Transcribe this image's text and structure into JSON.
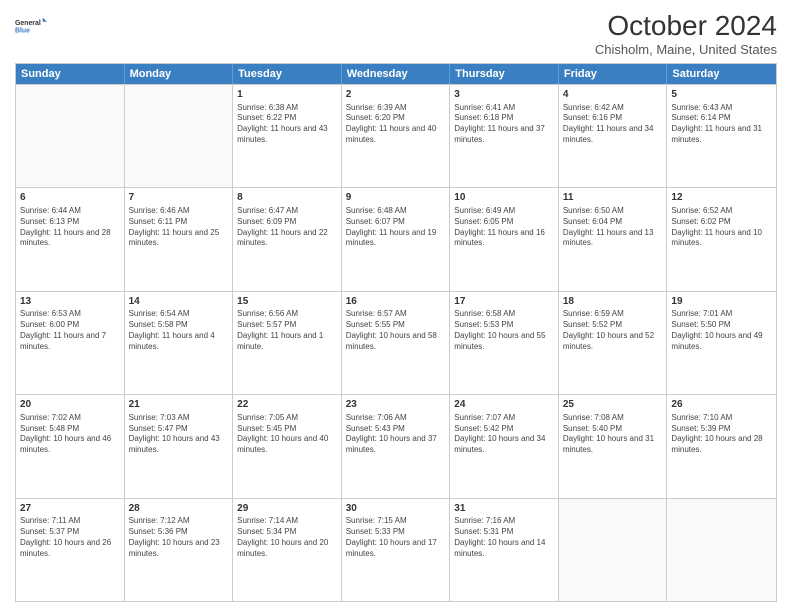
{
  "logo": {
    "line1": "General",
    "line2": "Blue",
    "icon_color": "#3a7fc1"
  },
  "header": {
    "title": "October 2024",
    "subtitle": "Chisholm, Maine, United States"
  },
  "weekdays": [
    "Sunday",
    "Monday",
    "Tuesday",
    "Wednesday",
    "Thursday",
    "Friday",
    "Saturday"
  ],
  "weeks": [
    [
      {
        "day": "",
        "sunrise": "",
        "sunset": "",
        "daylight": ""
      },
      {
        "day": "",
        "sunrise": "",
        "sunset": "",
        "daylight": ""
      },
      {
        "day": "1",
        "sunrise": "Sunrise: 6:38 AM",
        "sunset": "Sunset: 6:22 PM",
        "daylight": "Daylight: 11 hours and 43 minutes."
      },
      {
        "day": "2",
        "sunrise": "Sunrise: 6:39 AM",
        "sunset": "Sunset: 6:20 PM",
        "daylight": "Daylight: 11 hours and 40 minutes."
      },
      {
        "day": "3",
        "sunrise": "Sunrise: 6:41 AM",
        "sunset": "Sunset: 6:18 PM",
        "daylight": "Daylight: 11 hours and 37 minutes."
      },
      {
        "day": "4",
        "sunrise": "Sunrise: 6:42 AM",
        "sunset": "Sunset: 6:16 PM",
        "daylight": "Daylight: 11 hours and 34 minutes."
      },
      {
        "day": "5",
        "sunrise": "Sunrise: 6:43 AM",
        "sunset": "Sunset: 6:14 PM",
        "daylight": "Daylight: 11 hours and 31 minutes."
      }
    ],
    [
      {
        "day": "6",
        "sunrise": "Sunrise: 6:44 AM",
        "sunset": "Sunset: 6:13 PM",
        "daylight": "Daylight: 11 hours and 28 minutes."
      },
      {
        "day": "7",
        "sunrise": "Sunrise: 6:46 AM",
        "sunset": "Sunset: 6:11 PM",
        "daylight": "Daylight: 11 hours and 25 minutes."
      },
      {
        "day": "8",
        "sunrise": "Sunrise: 6:47 AM",
        "sunset": "Sunset: 6:09 PM",
        "daylight": "Daylight: 11 hours and 22 minutes."
      },
      {
        "day": "9",
        "sunrise": "Sunrise: 6:48 AM",
        "sunset": "Sunset: 6:07 PM",
        "daylight": "Daylight: 11 hours and 19 minutes."
      },
      {
        "day": "10",
        "sunrise": "Sunrise: 6:49 AM",
        "sunset": "Sunset: 6:05 PM",
        "daylight": "Daylight: 11 hours and 16 minutes."
      },
      {
        "day": "11",
        "sunrise": "Sunrise: 6:50 AM",
        "sunset": "Sunset: 6:04 PM",
        "daylight": "Daylight: 11 hours and 13 minutes."
      },
      {
        "day": "12",
        "sunrise": "Sunrise: 6:52 AM",
        "sunset": "Sunset: 6:02 PM",
        "daylight": "Daylight: 11 hours and 10 minutes."
      }
    ],
    [
      {
        "day": "13",
        "sunrise": "Sunrise: 6:53 AM",
        "sunset": "Sunset: 6:00 PM",
        "daylight": "Daylight: 11 hours and 7 minutes."
      },
      {
        "day": "14",
        "sunrise": "Sunrise: 6:54 AM",
        "sunset": "Sunset: 5:58 PM",
        "daylight": "Daylight: 11 hours and 4 minutes."
      },
      {
        "day": "15",
        "sunrise": "Sunrise: 6:56 AM",
        "sunset": "Sunset: 5:57 PM",
        "daylight": "Daylight: 11 hours and 1 minute."
      },
      {
        "day": "16",
        "sunrise": "Sunrise: 6:57 AM",
        "sunset": "Sunset: 5:55 PM",
        "daylight": "Daylight: 10 hours and 58 minutes."
      },
      {
        "day": "17",
        "sunrise": "Sunrise: 6:58 AM",
        "sunset": "Sunset: 5:53 PM",
        "daylight": "Daylight: 10 hours and 55 minutes."
      },
      {
        "day": "18",
        "sunrise": "Sunrise: 6:59 AM",
        "sunset": "Sunset: 5:52 PM",
        "daylight": "Daylight: 10 hours and 52 minutes."
      },
      {
        "day": "19",
        "sunrise": "Sunrise: 7:01 AM",
        "sunset": "Sunset: 5:50 PM",
        "daylight": "Daylight: 10 hours and 49 minutes."
      }
    ],
    [
      {
        "day": "20",
        "sunrise": "Sunrise: 7:02 AM",
        "sunset": "Sunset: 5:48 PM",
        "daylight": "Daylight: 10 hours and 46 minutes."
      },
      {
        "day": "21",
        "sunrise": "Sunrise: 7:03 AM",
        "sunset": "Sunset: 5:47 PM",
        "daylight": "Daylight: 10 hours and 43 minutes."
      },
      {
        "day": "22",
        "sunrise": "Sunrise: 7:05 AM",
        "sunset": "Sunset: 5:45 PM",
        "daylight": "Daylight: 10 hours and 40 minutes."
      },
      {
        "day": "23",
        "sunrise": "Sunrise: 7:06 AM",
        "sunset": "Sunset: 5:43 PM",
        "daylight": "Daylight: 10 hours and 37 minutes."
      },
      {
        "day": "24",
        "sunrise": "Sunrise: 7:07 AM",
        "sunset": "Sunset: 5:42 PM",
        "daylight": "Daylight: 10 hours and 34 minutes."
      },
      {
        "day": "25",
        "sunrise": "Sunrise: 7:08 AM",
        "sunset": "Sunset: 5:40 PM",
        "daylight": "Daylight: 10 hours and 31 minutes."
      },
      {
        "day": "26",
        "sunrise": "Sunrise: 7:10 AM",
        "sunset": "Sunset: 5:39 PM",
        "daylight": "Daylight: 10 hours and 28 minutes."
      }
    ],
    [
      {
        "day": "27",
        "sunrise": "Sunrise: 7:11 AM",
        "sunset": "Sunset: 5:37 PM",
        "daylight": "Daylight: 10 hours and 26 minutes."
      },
      {
        "day": "28",
        "sunrise": "Sunrise: 7:12 AM",
        "sunset": "Sunset: 5:36 PM",
        "daylight": "Daylight: 10 hours and 23 minutes."
      },
      {
        "day": "29",
        "sunrise": "Sunrise: 7:14 AM",
        "sunset": "Sunset: 5:34 PM",
        "daylight": "Daylight: 10 hours and 20 minutes."
      },
      {
        "day": "30",
        "sunrise": "Sunrise: 7:15 AM",
        "sunset": "Sunset: 5:33 PM",
        "daylight": "Daylight: 10 hours and 17 minutes."
      },
      {
        "day": "31",
        "sunrise": "Sunrise: 7:16 AM",
        "sunset": "Sunset: 5:31 PM",
        "daylight": "Daylight: 10 hours and 14 minutes."
      },
      {
        "day": "",
        "sunrise": "",
        "sunset": "",
        "daylight": ""
      },
      {
        "day": "",
        "sunrise": "",
        "sunset": "",
        "daylight": ""
      }
    ]
  ]
}
